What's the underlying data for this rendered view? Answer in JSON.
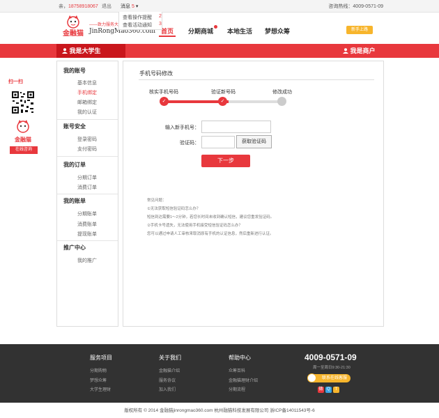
{
  "topbar": {
    "greeting": "亲，",
    "user_phone": "18758918067",
    "logout": "退出",
    "messages_label": "消息",
    "messages_count": "5",
    "caret": "▾",
    "hotline": "咨询热线：4009-0571-09"
  },
  "message_dropdown": [
    {
      "label": "查看操作提醒",
      "count": "2"
    },
    {
      "label": "查看活动通知",
      "count": "3"
    }
  ],
  "logo": {
    "cn_text": "金融猫",
    "slogan": "——致力服务大",
    "url_text": "JinRongMao360.com"
  },
  "nav": {
    "items": [
      "首页",
      "分期商城",
      "本地生活",
      "梦想众筹"
    ],
    "active": "首页",
    "newbie_badge": "新手上路"
  },
  "redbar": {
    "student_label": "我是大学生",
    "merchant_label": "我是商户"
  },
  "float_panel": {
    "scan_label": "扫一扫",
    "brand": "金融猫",
    "online_label": "在线咨询"
  },
  "sidebar": {
    "sections": [
      {
        "title": "我的账号",
        "items": [
          "基本信息",
          "手机绑定",
          "邮箱绑定",
          "我的认证"
        ]
      },
      {
        "title": "账号安全",
        "items": [
          "登录密码",
          "支付密码"
        ]
      },
      {
        "title": "我的订单",
        "items": [
          "分期订单",
          "消费订单"
        ]
      },
      {
        "title": "我的账单",
        "items": [
          "分期账单",
          "消费账单",
          "提现账单"
        ]
      },
      {
        "title": "推广中心",
        "items": [
          "我的推广"
        ]
      }
    ],
    "active_item": "手机绑定"
  },
  "main": {
    "title": "手机号码修改",
    "steps": [
      "核实手机号码",
      "验证新号码",
      "修改成功"
    ],
    "step_checks": [
      "✓",
      "✓"
    ],
    "current_step": 2,
    "progress_fraction": 0.55,
    "form": {
      "new_phone_label": "输入新手机号：",
      "new_phone_value": "",
      "code_label": "验证码：",
      "code_value": "",
      "get_code_button": "获取验证码",
      "submit_button": "下一步"
    },
    "faq": {
      "title": "常见问题：",
      "lines": [
        "①无法获取短信验证码怎么办？",
        "短信到达需要1～2分钟，若您长时间未收到确认短信，建议您重发验证码。",
        "②手机卡号遗失，无法使用手机接受短信验证码怎么办？",
        "您可以通过申请人工审核来取消原有手机的认证信息，然后重新进行认证。"
      ]
    }
  },
  "footer": {
    "columns": [
      {
        "title": "服务项目",
        "links": [
          "分期购物",
          "梦想众筹",
          "大学生理财"
        ]
      },
      {
        "title": "关于我们",
        "links": [
          "金融猫介绍",
          "服务协议",
          "加入我们"
        ]
      },
      {
        "title": "帮助中心",
        "links": [
          "众筹百科",
          "金融猫理财介绍",
          "分期流程"
        ]
      }
    ],
    "phone": "4009-0571-09",
    "hours": "周一至周日9:30-21:30",
    "service_button": "联系在线客服",
    "social_icons": [
      "weibo-icon",
      "qq-icon",
      "tencent-weibo-icon"
    ],
    "colors": {
      "weibo": "#e8383d",
      "qq": "#3aa3e3",
      "tweibo": "#f7b52c"
    }
  },
  "copyright": "版权所有 © 2014 金融猫jinrongmao360.com   杭州融猫科技发展有限公司  浙ICP备14011543号-6",
  "colors": {
    "brand_red": "#e8383d",
    "dark_red": "#c9161c",
    "footer_bg": "#323232",
    "accent_yellow": "#f7b52c"
  }
}
